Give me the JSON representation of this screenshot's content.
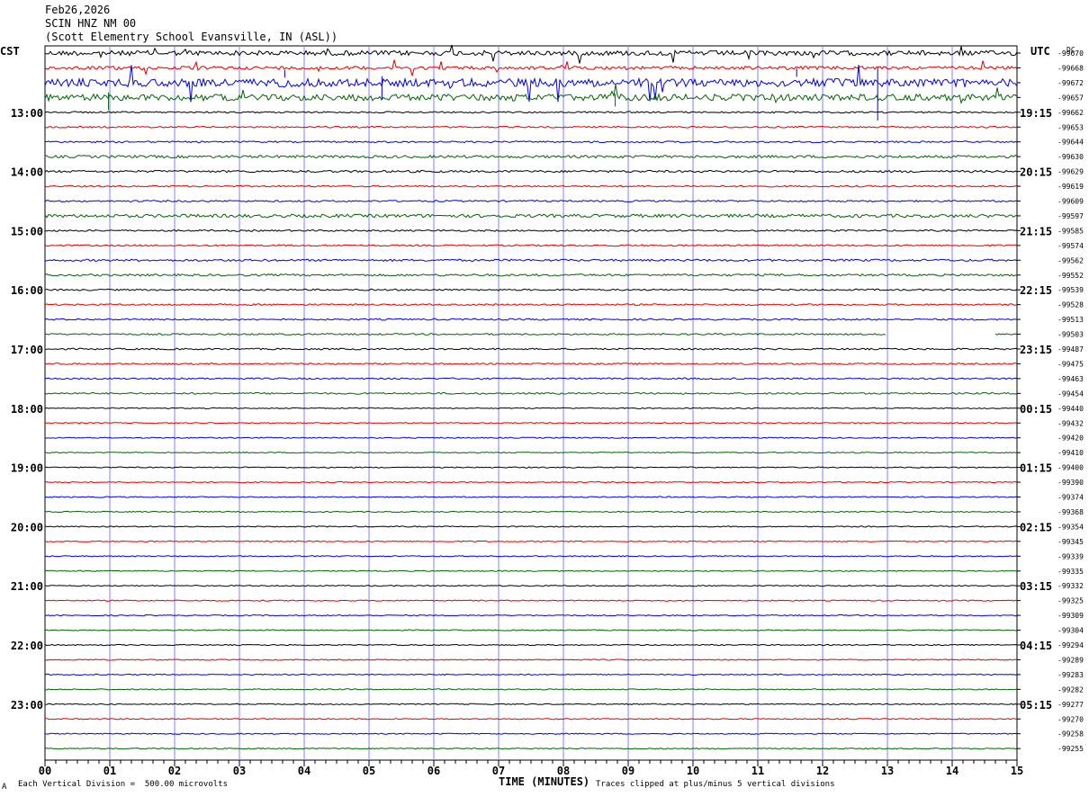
{
  "header": {
    "date": "Feb26,2026",
    "station": "SCIN HNZ NM 00",
    "location": "(Scott Elementry School Evansville, IN (ASL))"
  },
  "left_axis_label": "CST",
  "right_axis_label": "UTC",
  "dc_label": "DC",
  "footer": {
    "scale_note": "Each Vertical Division =  500.00 microvolts",
    "clip_note": "Traces clipped at plus/minus 5 vertical divisions",
    "corner_mark": "Α"
  },
  "colors": {
    "cycle": [
      "#000000",
      "#e00000",
      "#0000e0",
      "#006400"
    ],
    "grid": "#8080ff"
  },
  "chart_data": {
    "type": "line",
    "title": "SCIN HNZ NM 00",
    "xlabel": "TIME (MINUTES)",
    "xlim": [
      0,
      15
    ],
    "x_ticks": [
      "00",
      "01",
      "02",
      "03",
      "04",
      "05",
      "06",
      "07",
      "08",
      "09",
      "10",
      "11",
      "12",
      "13",
      "14",
      "15"
    ],
    "trace_count": 48,
    "minutes_per_trace": 15,
    "cst_labels": [
      {
        "trace": 4,
        "label": "13:00"
      },
      {
        "trace": 8,
        "label": "14:00"
      },
      {
        "trace": 12,
        "label": "15:00"
      },
      {
        "trace": 16,
        "label": "16:00"
      },
      {
        "trace": 20,
        "label": "17:00"
      },
      {
        "trace": 24,
        "label": "18:00"
      },
      {
        "trace": 28,
        "label": "19:00"
      },
      {
        "trace": 32,
        "label": "20:00"
      },
      {
        "trace": 36,
        "label": "21:00"
      },
      {
        "trace": 40,
        "label": "22:00"
      },
      {
        "trace": 44,
        "label": "23:00"
      }
    ],
    "utc_labels": [
      {
        "trace": 4,
        "label": "19:15"
      },
      {
        "trace": 8,
        "label": "20:15"
      },
      {
        "trace": 12,
        "label": "21:15"
      },
      {
        "trace": 16,
        "label": "22:15"
      },
      {
        "trace": 20,
        "label": "23:15"
      },
      {
        "trace": 24,
        "label": "00:15"
      },
      {
        "trace": 28,
        "label": "01:15"
      },
      {
        "trace": 32,
        "label": "02:15"
      },
      {
        "trace": 36,
        "label": "03:15"
      },
      {
        "trace": 40,
        "label": "04:15"
      },
      {
        "trace": 44,
        "label": "05:15"
      }
    ],
    "dc_offsets": [
      "-99670",
      "-99668",
      "-99672",
      "-99657",
      "-99662",
      "-99653",
      "-99644",
      "-99630",
      "-99629",
      "-99619",
      "-99609",
      "-99597",
      "-99585",
      "-99574",
      "-99562",
      "-99552",
      "-99539",
      "-99528",
      "-99513",
      "-99503",
      "-99487",
      "-99475",
      "-99463",
      "-99454",
      "-99440",
      "-99432",
      "-99420",
      "-99410",
      "-99400",
      "-99390",
      "-99374",
      "-99368",
      "-99354",
      "-99345",
      "-99339",
      "-99335",
      "-99332",
      "-99325",
      "-99309",
      "-99304",
      "-99294",
      "-99289",
      "-99283",
      "-99282",
      "-99277",
      "-99270",
      "-99258",
      "-99255"
    ],
    "noise_levels": [
      0.9,
      0.6,
      1.5,
      1.2,
      0.3,
      0.3,
      0.3,
      0.5,
      0.4,
      0.3,
      0.3,
      0.6,
      0.3,
      0.3,
      0.4,
      0.4,
      0.3,
      0.3,
      0.3,
      0.3,
      0.3,
      0.3,
      0.3,
      0.3,
      0.2,
      0.2,
      0.2,
      0.2,
      0.2,
      0.2,
      0.2,
      0.2,
      0.2,
      0.2,
      0.2,
      0.2,
      0.2,
      0.2,
      0.2,
      0.2,
      0.2,
      0.2,
      0.2,
      0.2,
      0.2,
      0.2,
      0.2,
      0.2
    ],
    "data_gaps": [
      {
        "trace": 19,
        "start_min": 13.0,
        "end_min": 14.65
      }
    ]
  }
}
